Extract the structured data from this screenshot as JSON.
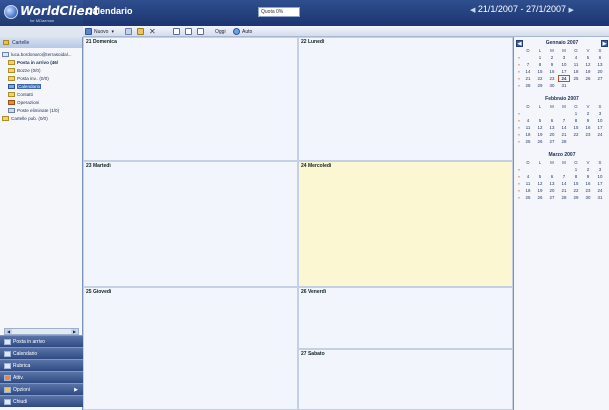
{
  "header": {
    "app_name": "WorldClient",
    "app_sub": "for MDaemon",
    "title": "Calendario",
    "quota": "Quota 0%",
    "date_range": "21/1/2007 - 27/1/2007"
  },
  "toolbar": {
    "new_label": "Nuovo",
    "today_label": "Oggi",
    "auto_label": "Auto"
  },
  "sidebar": {
    "header": "Cartelle",
    "tree": [
      {
        "label": "luca.bordonaro@terrasoidal...",
        "bold": false,
        "selected": false
      },
      {
        "label": "Posta in arrivo (46/",
        "bold": true,
        "selected": false
      },
      {
        "label": "Bozze (0/0)",
        "bold": false,
        "selected": false
      },
      {
        "label": "Posta inv.. (0/0)",
        "bold": false,
        "selected": false
      },
      {
        "label": "Calendario",
        "bold": false,
        "selected": true
      },
      {
        "label": "Contatti",
        "bold": false,
        "selected": false
      },
      {
        "label": "Operazioni",
        "bold": false,
        "selected": false
      },
      {
        "label": "Poste eliminate (1/0)",
        "bold": false,
        "selected": false
      },
      {
        "label": "Cartelle pub. (0/0)",
        "bold": false,
        "selected": false
      }
    ],
    "nav": [
      "Posta in arrivo",
      "Calendario",
      "Rubrica",
      "Attiv.",
      "Opzioni",
      "Chiudi"
    ]
  },
  "calendar": {
    "days": [
      {
        "label": "21 Domenica"
      },
      {
        "label": "22 Lunedì"
      },
      {
        "label": "23 Martedì"
      },
      {
        "label": "24 Mercoledì"
      },
      {
        "label": "25 Giovedì"
      },
      {
        "label": "26 Venerdì"
      },
      {
        "label": "27 Sabato"
      }
    ]
  },
  "mini_calendars": {
    "weekdays": [
      "D",
      "L",
      "M",
      "M",
      "G",
      "V",
      "S"
    ],
    "months": [
      {
        "title": "Gennaio 2007",
        "weeks": [
          [
            "",
            "1",
            "2",
            "3",
            "4",
            "5",
            "6"
          ],
          [
            "7",
            "8",
            "9",
            "10",
            "11",
            "12",
            "13"
          ],
          [
            "14",
            "15",
            "16",
            "17",
            "18",
            "19",
            "20"
          ],
          [
            "21",
            "22",
            "23",
            "24",
            "25",
            "26",
            "27"
          ],
          [
            "28",
            "29",
            "30",
            "31",
            "",
            "",
            ""
          ]
        ]
      },
      {
        "title": "Febbraio 2007",
        "weeks": [
          [
            "",
            "",
            "",
            "",
            "1",
            "2",
            "3"
          ],
          [
            "4",
            "5",
            "6",
            "7",
            "8",
            "9",
            "10"
          ],
          [
            "11",
            "12",
            "13",
            "14",
            "15",
            "16",
            "17"
          ],
          [
            "18",
            "19",
            "20",
            "21",
            "22",
            "23",
            "24"
          ],
          [
            "25",
            "26",
            "27",
            "28",
            "",
            "",
            ""
          ]
        ]
      },
      {
        "title": "Marzo 2007",
        "weeks": [
          [
            "",
            "",
            "",
            "",
            "1",
            "2",
            "3"
          ],
          [
            "4",
            "5",
            "6",
            "7",
            "8",
            "9",
            "10"
          ],
          [
            "11",
            "12",
            "13",
            "14",
            "15",
            "16",
            "17"
          ],
          [
            "18",
            "19",
            "20",
            "21",
            "22",
            "23",
            "24"
          ],
          [
            "25",
            "26",
            "27",
            "28",
            "29",
            "30",
            "31"
          ]
        ]
      }
    ],
    "highlight": "24",
    "colors": {
      "today_border": "#d24a1a",
      "week_marker": "#c35a22"
    }
  }
}
